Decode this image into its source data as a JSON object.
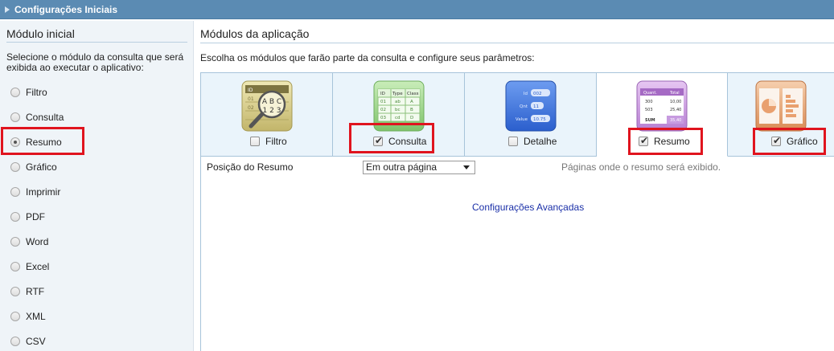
{
  "titlebar": {
    "title": "Configurações Iniciais"
  },
  "left": {
    "heading": "Módulo inicial",
    "description": "Selecione o módulo da consulta que será exibida ao executar o aplicativo:",
    "options": [
      {
        "label": "Filtro",
        "selected": false
      },
      {
        "label": "Consulta",
        "selected": false
      },
      {
        "label": "Resumo",
        "selected": true
      },
      {
        "label": "Gráfico",
        "selected": false
      },
      {
        "label": "Imprimir",
        "selected": false
      },
      {
        "label": "PDF",
        "selected": false
      },
      {
        "label": "Word",
        "selected": false
      },
      {
        "label": "Excel",
        "selected": false
      },
      {
        "label": "RTF",
        "selected": false
      },
      {
        "label": "XML",
        "selected": false
      },
      {
        "label": "CSV",
        "selected": false
      }
    ]
  },
  "right": {
    "heading": "Módulos da aplicação",
    "description": "Escolha os módulos que farão parte da consulta e configure seus parâmetros:",
    "modules": [
      {
        "label": "Filtro",
        "checked": false,
        "icon": "filter-abc-icon",
        "icon_text": [
          "ID",
          "01",
          "02",
          "A B C",
          "1 2 3"
        ]
      },
      {
        "label": "Consulta",
        "checked": true,
        "icon": "grid-query-icon",
        "icon_text": [
          "ID",
          "Type",
          "Class",
          "01",
          "ab",
          "A",
          "02",
          "bc",
          "B",
          "03",
          "cd",
          "D"
        ]
      },
      {
        "label": "Detalhe",
        "checked": false,
        "icon": "detail-form-icon",
        "icon_text": [
          "Id",
          "002",
          "Qnt",
          "11",
          "Value",
          "10.75"
        ]
      },
      {
        "label": "Resumo",
        "checked": true,
        "icon": "summary-table-icon",
        "icon_text": [
          "Quant.",
          "Total",
          "300",
          "10,00",
          "503",
          "25,40",
          "SUM",
          "35,40"
        ]
      },
      {
        "label": "Gráfico",
        "checked": true,
        "icon": "chart-icon",
        "icon_text": []
      }
    ],
    "position_label": "Posição do Resumo",
    "position_value": "Em outra página",
    "position_hint": "Páginas onde o resumo será exibido.",
    "advanced_link": "Configurações Avançadas"
  },
  "colors": {
    "titlebar": "#5b8bb3",
    "highlight": "#e0141e",
    "link": "#1a2fa8",
    "tab_bg": "#eaf4fb"
  }
}
